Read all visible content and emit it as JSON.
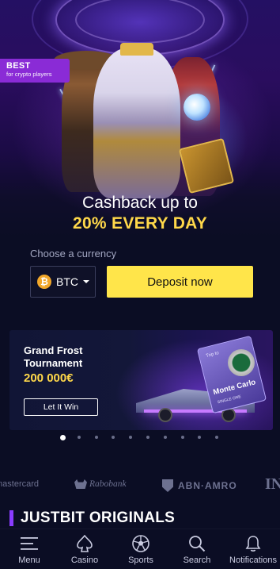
{
  "hero": {
    "badge_title": "BEST",
    "badge_subtitle": "for crypto players",
    "promo_line1": "Cashback up to",
    "promo_line2": "20% EVERY DAY",
    "currency_label": "Choose a currency",
    "currency_value": "BTC",
    "currency_symbol": "₿",
    "deposit_label": "Deposit now"
  },
  "tournament": {
    "title": "Grand Frost Tournament",
    "prize": "200 000€",
    "button_label": "Let It Win",
    "ticket_top": "Trip to",
    "ticket_main": "Monte Carlo",
    "ticket_foot": "SINGLE ONE"
  },
  "carousel": {
    "total_slides": 10,
    "active_index": 0
  },
  "payment_logos": {
    "mastercard": "mastercard",
    "rabobank": "Rabobank",
    "abnamro": "ABN·AMRO",
    "ing": "IN"
  },
  "originals": {
    "title": "JUSTBIT ORIGINALS"
  },
  "bottom_nav": {
    "menu": "Menu",
    "casino": "Casino",
    "sports": "Sports",
    "search": "Search",
    "notifications": "Notifications"
  },
  "colors": {
    "accent_yellow": "#ffe54a",
    "promo_yellow": "#ffd84a",
    "badge_purple": "#8a2bd6",
    "heading_bar": "#8a3cff",
    "background": "#0b0d24"
  }
}
